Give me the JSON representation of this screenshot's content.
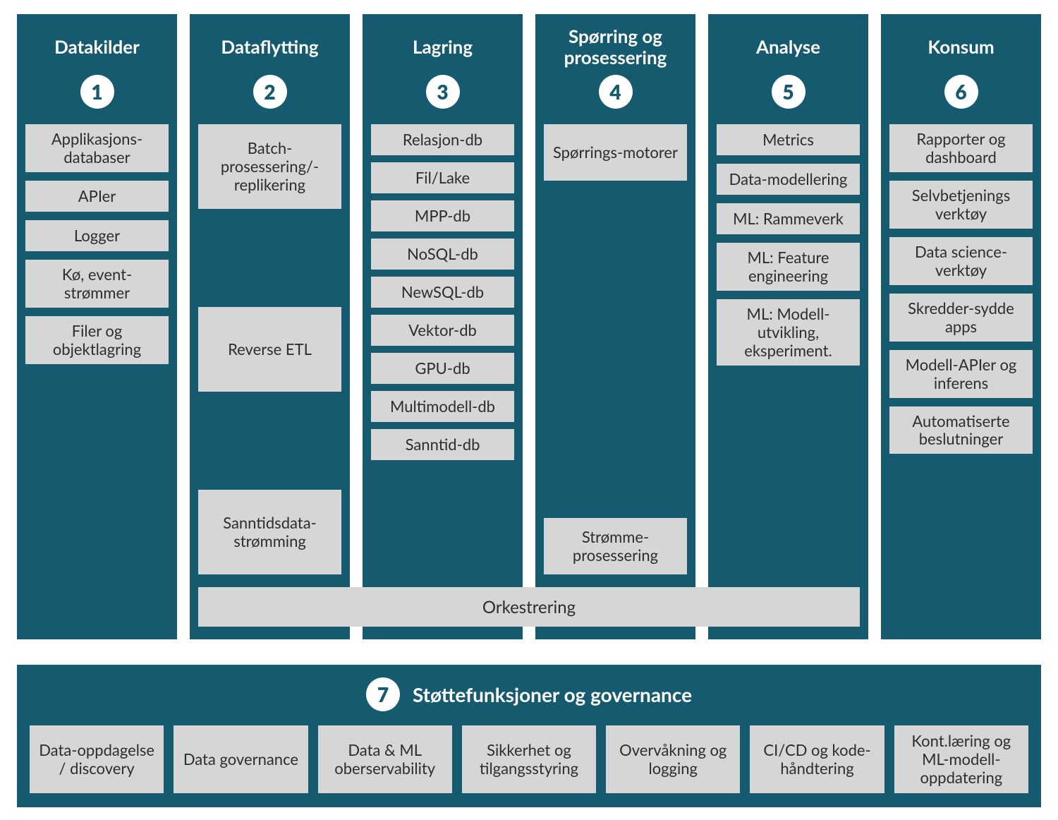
{
  "columns": [
    {
      "number": "1",
      "title": "Datakilder",
      "items": [
        "Applikasjons-databaser",
        "APIer",
        "Logger",
        "Kø, event-strømmer",
        "Filer og objektlagring"
      ]
    },
    {
      "number": "2",
      "title": "Dataflytting",
      "items_lg": [
        "Batch-prosessering/-replikering",
        "Reverse ETL",
        "Sanntidsdata-strømming"
      ]
    },
    {
      "number": "3",
      "title": "Lagring",
      "items": [
        "Relasjon-db",
        "Fil/Lake",
        "MPP-db",
        "NoSQL-db",
        "NewSQL-db",
        "Vektor-db",
        "GPU-db",
        "Multimodell-db",
        "Sanntid-db"
      ]
    },
    {
      "number": "4",
      "title": "Spørring og prosessering",
      "top_item": "Spørrings-motorer",
      "bottom_item": "Strømme-prosessering"
    },
    {
      "number": "5",
      "title": "Analyse",
      "items": [
        "Metrics",
        "Data-modellering",
        "ML: Rammeverk",
        "ML: Feature engineering",
        "ML: Modell-utvikling, eksperiment."
      ]
    },
    {
      "number": "6",
      "title": "Konsum",
      "items": [
        "Rapporter og dashboard",
        "Selvbetjenings verktøy",
        "Data science-verktøy",
        "Skredder-sydde apps",
        "Modell-APIer og inferens",
        "Automatiserte beslutninger"
      ]
    }
  ],
  "ork_label": "Orkestrering",
  "bottom": {
    "number": "7",
    "title": "Støttefunksjoner og governance",
    "items": [
      "Data-oppdagelse / discovery",
      "Data governance",
      "Data & ML oberservability",
      "Sikkerhet og tilgangsstyring",
      "Overvåkning og logging",
      "CI/CD og kode-håndtering",
      "Kont.læring og ML-modell-oppdatering"
    ]
  },
  "colors": {
    "panel": "#155a6e",
    "chip": "#d6d6d6",
    "text_light": "#ffffff",
    "text_dark": "#2b2d2f"
  }
}
